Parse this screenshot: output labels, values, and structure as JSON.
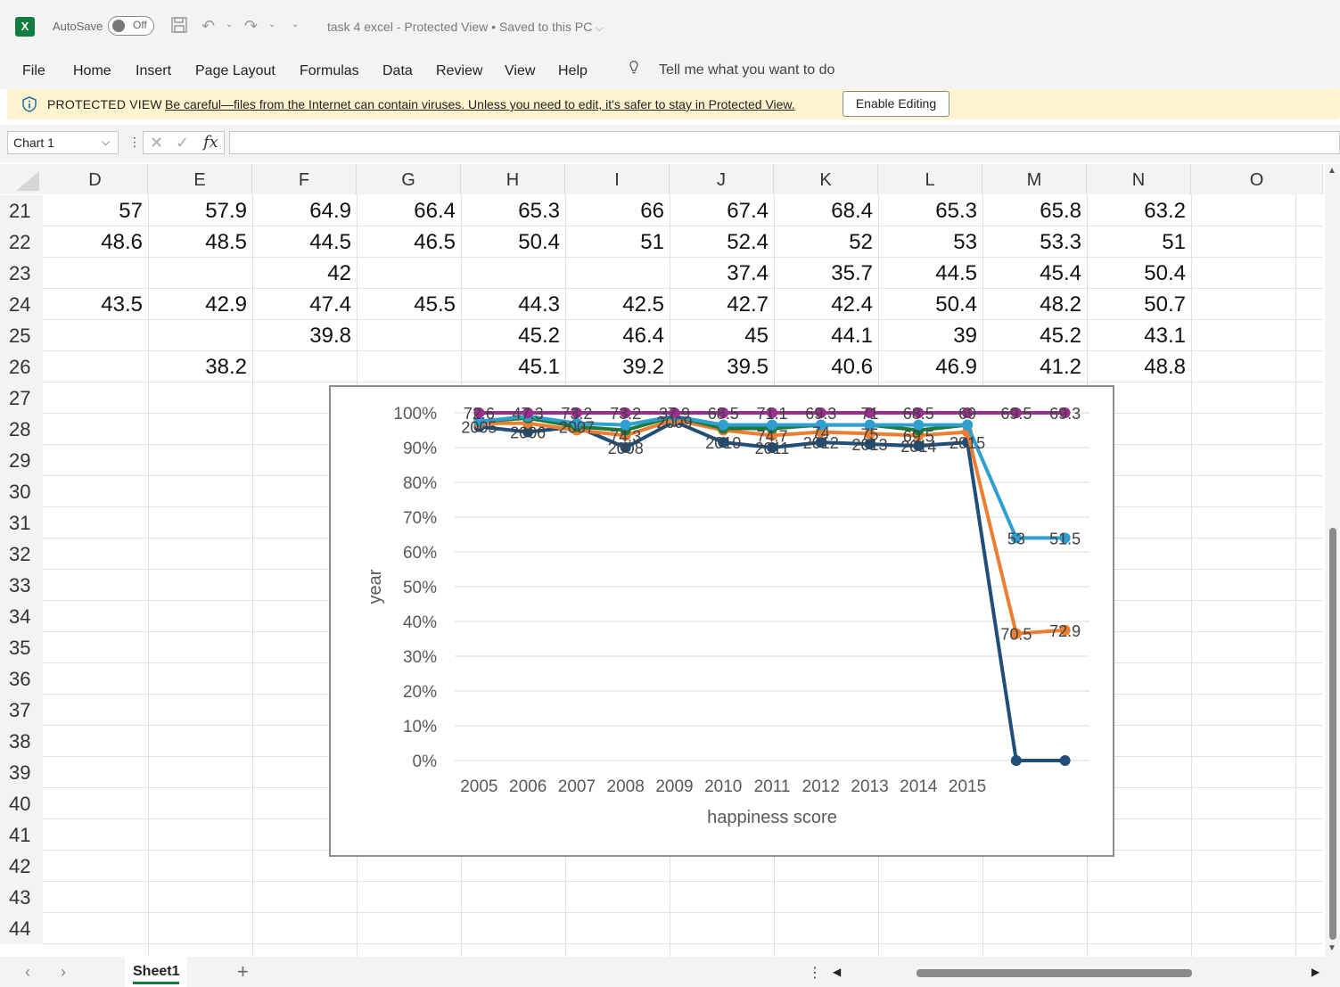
{
  "titlebar": {
    "autosave_label": "AutoSave",
    "toggle_state": "Off",
    "document_title": "task 4 excel  -  Protected View • Saved to this PC"
  },
  "menu": {
    "items": [
      "File",
      "Home",
      "Insert",
      "Page Layout",
      "Formulas",
      "Data",
      "Review",
      "View",
      "Help"
    ],
    "tell_me": "Tell me what you want to do"
  },
  "protected_view": {
    "label": "PROTECTED VIEW",
    "message": "Be careful—files from the Internet can contain viruses. Unless you need to edit, it's safer to stay in Protected View.",
    "button": "Enable Editing"
  },
  "formula_bar": {
    "name_box": "Chart 1",
    "fx_label": "fx",
    "formula": ""
  },
  "columns": [
    "D",
    "E",
    "F",
    "G",
    "H",
    "I",
    "J",
    "K",
    "L",
    "M",
    "N",
    "O"
  ],
  "rows": [
    {
      "num": "21",
      "cells": [
        "57",
        "57.9",
        "64.9",
        "66.4",
        "65.3",
        "66",
        "67.4",
        "68.4",
        "65.3",
        "65.8",
        "63.2",
        ""
      ]
    },
    {
      "num": "22",
      "cells": [
        "48.6",
        "48.5",
        "44.5",
        "46.5",
        "50.4",
        "51",
        "52.4",
        "52",
        "53",
        "53.3",
        "51",
        ""
      ]
    },
    {
      "num": "23",
      "cells": [
        "",
        "",
        "42",
        "",
        "",
        "",
        "37.4",
        "35.7",
        "44.5",
        "45.4",
        "50.4",
        ""
      ]
    },
    {
      "num": "24",
      "cells": [
        "43.5",
        "42.9",
        "47.4",
        "45.5",
        "44.3",
        "42.5",
        "42.7",
        "42.4",
        "50.4",
        "48.2",
        "50.7",
        ""
      ]
    },
    {
      "num": "25",
      "cells": [
        "",
        "",
        "39.8",
        "",
        "45.2",
        "46.4",
        "45",
        "44.1",
        "39",
        "45.2",
        "43.1",
        ""
      ]
    },
    {
      "num": "26",
      "cells": [
        "",
        "38.2",
        "",
        "",
        "45.1",
        "39.2",
        "39.5",
        "40.6",
        "46.9",
        "41.2",
        "48.8",
        ""
      ]
    },
    {
      "num": "27",
      "cells": []
    },
    {
      "num": "28",
      "cells": []
    },
    {
      "num": "29",
      "cells": []
    },
    {
      "num": "30",
      "cells": []
    },
    {
      "num": "31",
      "cells": []
    },
    {
      "num": "32",
      "cells": []
    },
    {
      "num": "33",
      "cells": []
    },
    {
      "num": "34",
      "cells": []
    },
    {
      "num": "35",
      "cells": []
    },
    {
      "num": "36",
      "cells": []
    },
    {
      "num": "37",
      "cells": []
    },
    {
      "num": "38",
      "cells": []
    },
    {
      "num": "39",
      "cells": []
    },
    {
      "num": "40",
      "cells": []
    },
    {
      "num": "41",
      "cells": []
    },
    {
      "num": "42",
      "cells": []
    },
    {
      "num": "43",
      "cells": []
    },
    {
      "num": "44",
      "cells": []
    }
  ],
  "sheets": {
    "active": "Sheet1",
    "add_label": "+"
  },
  "chart_data": {
    "type": "line",
    "subtype": "100% stacked line with markers",
    "title": "",
    "xlabel": "happiness score",
    "ylabel": "year",
    "ylim": [
      0,
      1
    ],
    "y_ticks": [
      "0%",
      "10%",
      "20%",
      "30%",
      "40%",
      "50%",
      "60%",
      "70%",
      "80%",
      "90%",
      "100%"
    ],
    "categories": [
      "2005",
      "2006",
      "2007",
      "2008",
      "2009",
      "2010",
      "2011",
      "2012",
      "2013",
      "2014",
      "2015",
      "",
      ""
    ],
    "grid": true,
    "legend": "none",
    "series": [
      {
        "color": "#1f4e79",
        "values": [
          0.96,
          0.945,
          0.96,
          0.9,
          0.975,
          0.915,
          0.9,
          0.915,
          0.91,
          0.905,
          0.915,
          0.0,
          0.0
        ],
        "labels": [
          "2005",
          "2006",
          "2007",
          "2008",
          "2009",
          "2010",
          "2011",
          "2012",
          "2013",
          "2014",
          "2015",
          "",
          ""
        ]
      },
      {
        "color": "#ed7d31",
        "values": [
          0.97,
          0.97,
          0.95,
          0.935,
          0.98,
          0.95,
          0.935,
          0.945,
          0.94,
          0.935,
          0.945,
          0.365,
          0.375
        ],
        "labels": [
          "",
          "",
          "",
          "74.3",
          "",
          "",
          "74.7",
          "74",
          "75",
          "69.5",
          "",
          "70.5",
          "72.9"
        ]
      },
      {
        "color": "#1f7a3a",
        "values": [
          0.975,
          0.985,
          0.96,
          0.95,
          0.99,
          0.955,
          0.955,
          0.965,
          0.965,
          0.95,
          0.965,
          null,
          null
        ],
        "labels": [
          "",
          "",
          "",
          "",
          "",
          "",
          "",
          "",
          "",
          "",
          "",
          "",
          ""
        ]
      },
      {
        "color": "#2e9fd0",
        "values": [
          0.975,
          0.99,
          0.97,
          0.965,
          0.99,
          0.965,
          0.965,
          0.965,
          0.965,
          0.965,
          0.965,
          0.64,
          0.64
        ],
        "labels": [
          "",
          "",
          "",
          "",
          "",
          "",
          "",
          "",
          "",
          "",
          "",
          "53",
          "51.5"
        ]
      },
      {
        "color": "#9b2f8e",
        "values": [
          1,
          1,
          1,
          1,
          1,
          1,
          1,
          1,
          1,
          1,
          1,
          1,
          1
        ],
        "labels": [
          "72.6",
          "47.3",
          "73.2",
          "73.2",
          "37.9",
          "68.5",
          "71.1",
          "69.3",
          "71",
          "68.5",
          "69",
          "69.5",
          "69.3"
        ]
      }
    ]
  }
}
